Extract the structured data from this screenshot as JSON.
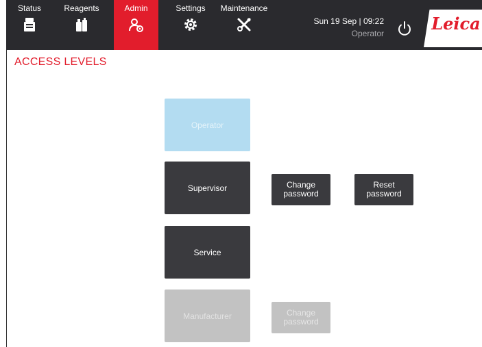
{
  "nav": {
    "tabs": [
      {
        "label": "Status",
        "icon": "status-icon"
      },
      {
        "label": "Reagents",
        "icon": "reagents-icon"
      },
      {
        "label": "Admin",
        "icon": "admin-icon"
      },
      {
        "label": "Settings",
        "icon": "settings-gear-icon"
      },
      {
        "label": "Maintenance",
        "icon": "maintenance-tools-icon"
      }
    ],
    "active_tab": "Admin",
    "datetime": "Sun 19 Sep | 09:22",
    "user_role": "Operator",
    "logo_text": "Leica"
  },
  "page": {
    "title": "ACCESS LEVELS"
  },
  "access_levels": {
    "operator": {
      "label": "Operator",
      "state": "active"
    },
    "supervisor": {
      "label": "Supervisor",
      "change_password": "Change password",
      "reset_password": "Reset password"
    },
    "service": {
      "label": "Service"
    },
    "manufacturer": {
      "label": "Manufacturer",
      "state": "disabled",
      "change_password": "Change password"
    }
  },
  "colors": {
    "accent": "#e21d2c",
    "topbar": "#2a2a2e",
    "button_dark": "#3a3a3e",
    "button_active": "#b3dcf1",
    "button_disabled": "#c2c2c2"
  }
}
